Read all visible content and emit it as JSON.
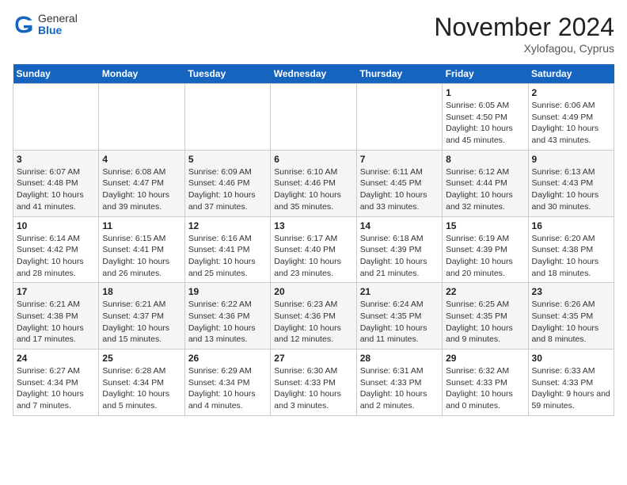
{
  "header": {
    "logo_general": "General",
    "logo_blue": "Blue",
    "month_title": "November 2024",
    "location": "Xylofagou, Cyprus"
  },
  "days_of_week": [
    "Sunday",
    "Monday",
    "Tuesday",
    "Wednesday",
    "Thursday",
    "Friday",
    "Saturday"
  ],
  "weeks": [
    [
      {
        "day": "",
        "info": ""
      },
      {
        "day": "",
        "info": ""
      },
      {
        "day": "",
        "info": ""
      },
      {
        "day": "",
        "info": ""
      },
      {
        "day": "",
        "info": ""
      },
      {
        "day": "1",
        "info": "Sunrise: 6:05 AM\nSunset: 4:50 PM\nDaylight: 10 hours and 45 minutes."
      },
      {
        "day": "2",
        "info": "Sunrise: 6:06 AM\nSunset: 4:49 PM\nDaylight: 10 hours and 43 minutes."
      }
    ],
    [
      {
        "day": "3",
        "info": "Sunrise: 6:07 AM\nSunset: 4:48 PM\nDaylight: 10 hours and 41 minutes."
      },
      {
        "day": "4",
        "info": "Sunrise: 6:08 AM\nSunset: 4:47 PM\nDaylight: 10 hours and 39 minutes."
      },
      {
        "day": "5",
        "info": "Sunrise: 6:09 AM\nSunset: 4:46 PM\nDaylight: 10 hours and 37 minutes."
      },
      {
        "day": "6",
        "info": "Sunrise: 6:10 AM\nSunset: 4:46 PM\nDaylight: 10 hours and 35 minutes."
      },
      {
        "day": "7",
        "info": "Sunrise: 6:11 AM\nSunset: 4:45 PM\nDaylight: 10 hours and 33 minutes."
      },
      {
        "day": "8",
        "info": "Sunrise: 6:12 AM\nSunset: 4:44 PM\nDaylight: 10 hours and 32 minutes."
      },
      {
        "day": "9",
        "info": "Sunrise: 6:13 AM\nSunset: 4:43 PM\nDaylight: 10 hours and 30 minutes."
      }
    ],
    [
      {
        "day": "10",
        "info": "Sunrise: 6:14 AM\nSunset: 4:42 PM\nDaylight: 10 hours and 28 minutes."
      },
      {
        "day": "11",
        "info": "Sunrise: 6:15 AM\nSunset: 4:41 PM\nDaylight: 10 hours and 26 minutes."
      },
      {
        "day": "12",
        "info": "Sunrise: 6:16 AM\nSunset: 4:41 PM\nDaylight: 10 hours and 25 minutes."
      },
      {
        "day": "13",
        "info": "Sunrise: 6:17 AM\nSunset: 4:40 PM\nDaylight: 10 hours and 23 minutes."
      },
      {
        "day": "14",
        "info": "Sunrise: 6:18 AM\nSunset: 4:39 PM\nDaylight: 10 hours and 21 minutes."
      },
      {
        "day": "15",
        "info": "Sunrise: 6:19 AM\nSunset: 4:39 PM\nDaylight: 10 hours and 20 minutes."
      },
      {
        "day": "16",
        "info": "Sunrise: 6:20 AM\nSunset: 4:38 PM\nDaylight: 10 hours and 18 minutes."
      }
    ],
    [
      {
        "day": "17",
        "info": "Sunrise: 6:21 AM\nSunset: 4:38 PM\nDaylight: 10 hours and 17 minutes."
      },
      {
        "day": "18",
        "info": "Sunrise: 6:21 AM\nSunset: 4:37 PM\nDaylight: 10 hours and 15 minutes."
      },
      {
        "day": "19",
        "info": "Sunrise: 6:22 AM\nSunset: 4:36 PM\nDaylight: 10 hours and 13 minutes."
      },
      {
        "day": "20",
        "info": "Sunrise: 6:23 AM\nSunset: 4:36 PM\nDaylight: 10 hours and 12 minutes."
      },
      {
        "day": "21",
        "info": "Sunrise: 6:24 AM\nSunset: 4:35 PM\nDaylight: 10 hours and 11 minutes."
      },
      {
        "day": "22",
        "info": "Sunrise: 6:25 AM\nSunset: 4:35 PM\nDaylight: 10 hours and 9 minutes."
      },
      {
        "day": "23",
        "info": "Sunrise: 6:26 AM\nSunset: 4:35 PM\nDaylight: 10 hours and 8 minutes."
      }
    ],
    [
      {
        "day": "24",
        "info": "Sunrise: 6:27 AM\nSunset: 4:34 PM\nDaylight: 10 hours and 7 minutes."
      },
      {
        "day": "25",
        "info": "Sunrise: 6:28 AM\nSunset: 4:34 PM\nDaylight: 10 hours and 5 minutes."
      },
      {
        "day": "26",
        "info": "Sunrise: 6:29 AM\nSunset: 4:34 PM\nDaylight: 10 hours and 4 minutes."
      },
      {
        "day": "27",
        "info": "Sunrise: 6:30 AM\nSunset: 4:33 PM\nDaylight: 10 hours and 3 minutes."
      },
      {
        "day": "28",
        "info": "Sunrise: 6:31 AM\nSunset: 4:33 PM\nDaylight: 10 hours and 2 minutes."
      },
      {
        "day": "29",
        "info": "Sunrise: 6:32 AM\nSunset: 4:33 PM\nDaylight: 10 hours and 0 minutes."
      },
      {
        "day": "30",
        "info": "Sunrise: 6:33 AM\nSunset: 4:33 PM\nDaylight: 9 hours and 59 minutes."
      }
    ]
  ]
}
